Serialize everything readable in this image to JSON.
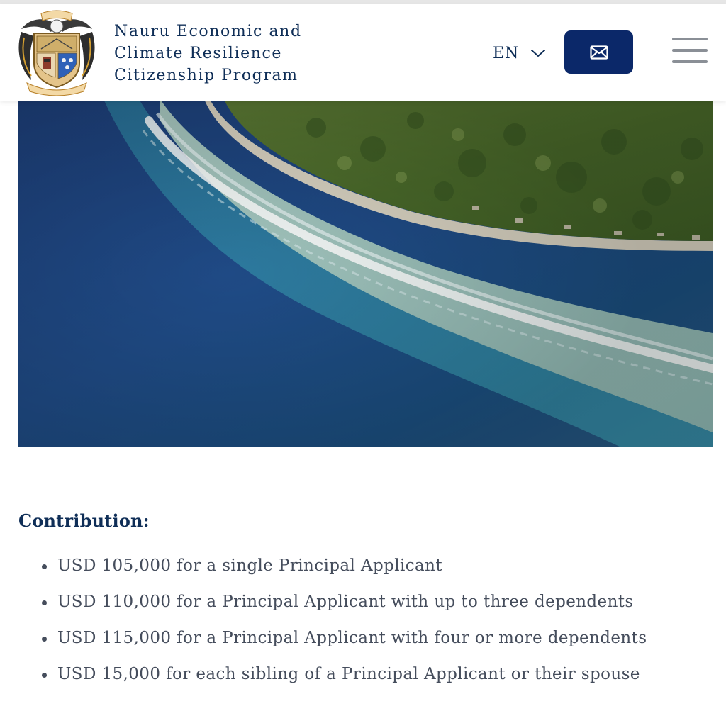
{
  "header": {
    "brand_lines": [
      "Nauru Economic and",
      "Climate Resilience",
      "Citizenship Program"
    ],
    "logo_text": [
      "NAOERO",
      "GOD'S WILL FIRST"
    ],
    "language": {
      "selected": "EN",
      "icon": "chevron-down-icon"
    },
    "mail_button_icon": "envelope-icon",
    "menu_icon": "hamburger-menu-icon"
  },
  "contribution": {
    "heading": "Contribution:",
    "items": [
      "USD 105,000 for a single Principal Applicant",
      "USD 110,000 for a Principal Applicant with up to three dependents",
      "USD 115,000 for a Principal Applicant with four or more dependents",
      "USD 15,000 for each sibling of a Principal Applicant or their spouse"
    ]
  },
  "colors": {
    "brand_navy": "#0f2e57",
    "button_navy": "#0b2869",
    "body_text": "#454d5c",
    "menu_gray": "#8a8f96"
  }
}
